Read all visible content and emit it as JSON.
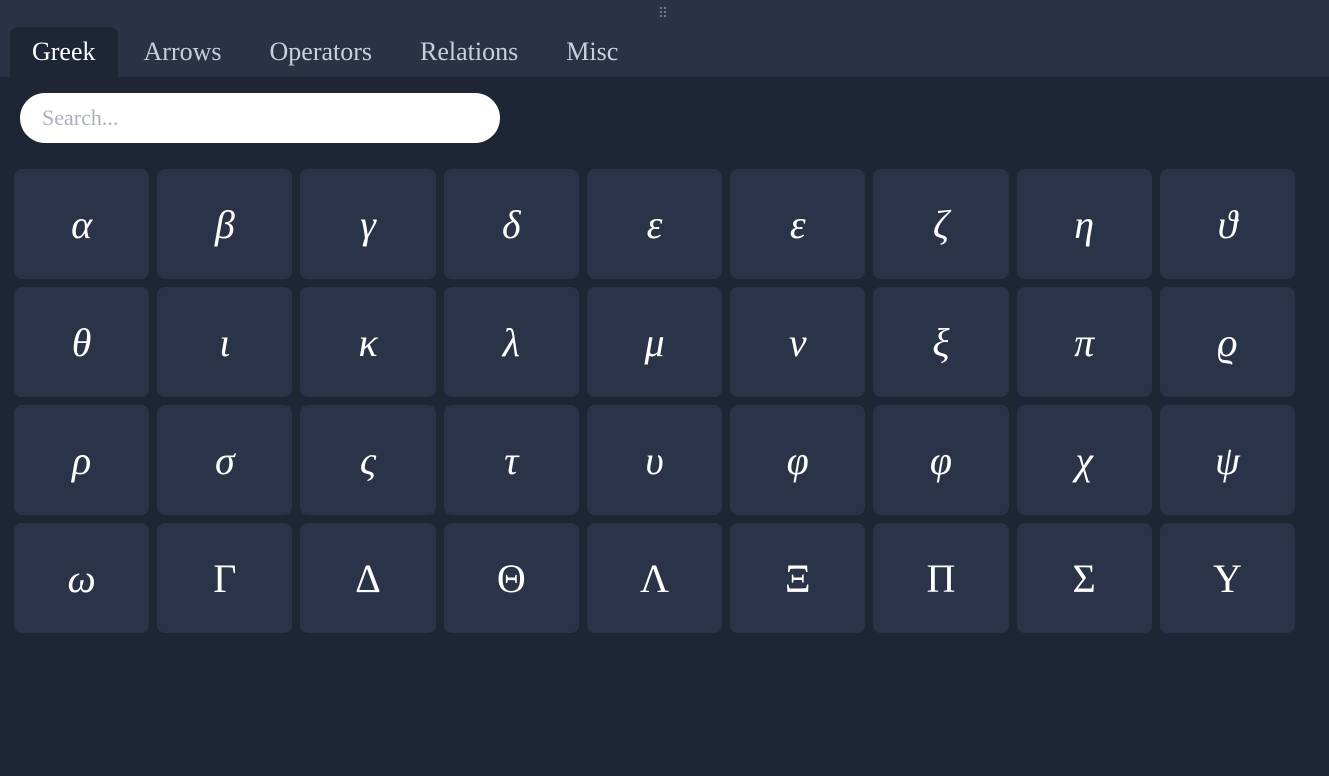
{
  "drag_handle": ".....",
  "tabs": [
    {
      "id": "greek",
      "label": "Greek",
      "active": true
    },
    {
      "id": "arrows",
      "label": "Arrows",
      "active": false
    },
    {
      "id": "operators",
      "label": "Operators",
      "active": false
    },
    {
      "id": "relations",
      "label": "Relations",
      "active": false
    },
    {
      "id": "misc",
      "label": "Misc",
      "active": false
    }
  ],
  "search": {
    "placeholder": "Search..."
  },
  "symbols": [
    {
      "char": "α",
      "name": "alpha",
      "upright": false
    },
    {
      "char": "β",
      "name": "beta",
      "upright": false
    },
    {
      "char": "γ",
      "name": "gamma",
      "upright": false
    },
    {
      "char": "δ",
      "name": "delta",
      "upright": false
    },
    {
      "char": "ε",
      "name": "varepsilon",
      "upright": false
    },
    {
      "char": "ε",
      "name": "epsilon",
      "upright": false
    },
    {
      "char": "ζ",
      "name": "zeta",
      "upright": false
    },
    {
      "char": "η",
      "name": "eta",
      "upright": false
    },
    {
      "char": "ϑ",
      "name": "vartheta",
      "upright": false
    },
    {
      "char": "θ",
      "name": "theta",
      "upright": false
    },
    {
      "char": "ι",
      "name": "iota",
      "upright": false
    },
    {
      "char": "κ",
      "name": "kappa",
      "upright": false
    },
    {
      "char": "λ",
      "name": "lambda",
      "upright": false
    },
    {
      "char": "μ",
      "name": "mu",
      "upright": false
    },
    {
      "char": "ν",
      "name": "nu",
      "upright": false
    },
    {
      "char": "ξ",
      "name": "xi",
      "upright": false
    },
    {
      "char": "π",
      "name": "pi",
      "upright": false
    },
    {
      "char": "ϱ",
      "name": "varrho",
      "upright": false
    },
    {
      "char": "ρ",
      "name": "rho",
      "upright": false
    },
    {
      "char": "σ",
      "name": "sigma",
      "upright": false
    },
    {
      "char": "ς",
      "name": "varsigma",
      "upright": false
    },
    {
      "char": "τ",
      "name": "tau",
      "upright": false
    },
    {
      "char": "υ",
      "name": "upsilon",
      "upright": false
    },
    {
      "char": "φ",
      "name": "phi",
      "upright": false
    },
    {
      "char": "φ",
      "name": "varphi",
      "upright": false
    },
    {
      "char": "χ",
      "name": "chi",
      "upright": false
    },
    {
      "char": "ψ",
      "name": "psi",
      "upright": false
    },
    {
      "char": "ω",
      "name": "omega",
      "upright": false
    },
    {
      "char": "Γ",
      "name": "Gamma",
      "upright": true
    },
    {
      "char": "Δ",
      "name": "Delta",
      "upright": true
    },
    {
      "char": "Θ",
      "name": "Theta",
      "upright": true
    },
    {
      "char": "Λ",
      "name": "Lambda",
      "upright": true
    },
    {
      "char": "Ξ",
      "name": "Xi",
      "upright": true
    },
    {
      "char": "Π",
      "name": "Pi",
      "upright": true
    },
    {
      "char": "Σ",
      "name": "Sigma",
      "upright": true
    },
    {
      "char": "Υ",
      "name": "Upsilon",
      "upright": true
    }
  ]
}
